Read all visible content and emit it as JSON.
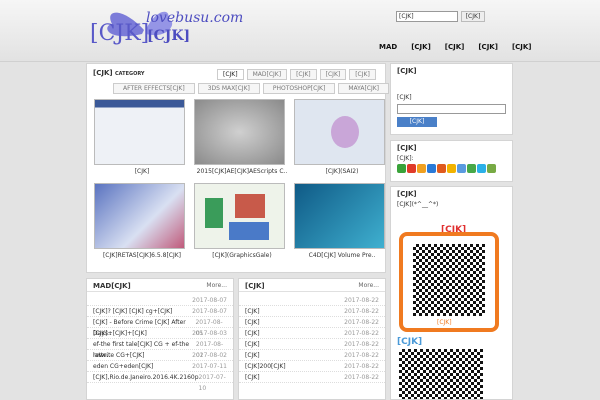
{
  "site": {
    "logo_text": "lovebusu.com",
    "logo_cjk": "[CJK]"
  },
  "search": {
    "placeholder": "[CJK]",
    "button": "[CJK]"
  },
  "nav": [
    "MAD",
    "[CJK]",
    "[CJK]",
    "[CJK]",
    "[CJK]"
  ],
  "category": {
    "title": "[CJK]",
    "title_en": "CATEGORY",
    "tabs": [
      "[CJK]",
      "MAD[CJK]",
      "[CJK]",
      "[CJK]",
      "[CJK]",
      "AFTER EFFECTS[CJK]",
      "3DS MAX[CJK]",
      "PHOTOSHOP[CJK]",
      "MAYA[CJK]"
    ],
    "items": [
      {
        "caption": "[CJK]",
        "thumb_color": "#3b5998"
      },
      {
        "caption": "2015[CJK]AE[CJK]AEScripts C..",
        "thumb_color": "#9c9c9c"
      },
      {
        "caption": "[CJK](SAI2)",
        "thumb_color": "#dfe6f0"
      },
      {
        "caption": "[CJK]RETAS[CJK]6.5.8[CJK]",
        "thumb_color": "#6a7fc0"
      },
      {
        "caption": "[CJK](GraphicsGale)",
        "thumb_color": "#d8e4ce"
      },
      {
        "caption": "C4D[CJK] Volume Pre..",
        "thumb_color": "#1f7fa8"
      }
    ]
  },
  "mad_list": {
    "title": "MAD[CJK]",
    "more": "More...",
    "rows": [
      {
        "t": "",
        "d": "2017-08-07"
      },
      {
        "t": "[CJK]? [CJK] [CJK] cg+[CJK]",
        "d": "2017-08-07"
      },
      {
        "t": "[CJK] - Before Crime [CJK] After Days..",
        "d": "2017-08-05"
      },
      {
        "t": "[CJK]+[CJK]+[CJK]",
        "d": "2017-08-03"
      },
      {
        "t": "ef-the first tale[CJK] CG + ef-the latte..",
        "d": "2017-08-02"
      },
      {
        "t": "rewrite CG+[CJK]",
        "d": "2017-08-02"
      },
      {
        "t": "eden CG+eden[CJK]",
        "d": "2017-07-11"
      },
      {
        "t": "[CJK],Rio.de.Janeiro.2016.4K.2160p",
        "d": "2017-07-10"
      }
    ]
  },
  "news_list": {
    "title": "[CJK]",
    "more": "More...",
    "rows": [
      {
        "t": "",
        "d": "2017-08-22"
      },
      {
        "t": "[CJK]",
        "d": "2017-08-22"
      },
      {
        "t": "[CJK]",
        "d": "2017-08-22"
      },
      {
        "t": "[CJK]",
        "d": "2017-08-22"
      },
      {
        "t": "[CJK]",
        "d": "2017-08-22"
      },
      {
        "t": "[CJK]",
        "d": "2017-08-22"
      },
      {
        "t": "[CJK]200[CJK]",
        "d": "2017-08-22"
      },
      {
        "t": "[CJK]",
        "d": "2017-08-22"
      }
    ]
  },
  "sidebar": {
    "login_title": "[CJK]",
    "login_hint": "[CJK]",
    "login_btn": "[CJK]",
    "share_title": "[CJK]",
    "share_hint": "[CJK]:",
    "share_colors": [
      "#3aa33a",
      "#e03b2a",
      "#f0a020",
      "#2a7ad8",
      "#e05a1e",
      "#f2b300",
      "#5a9be0",
      "#48a848",
      "#2bb0e8",
      "#7a4",
      "#4b4"
    ],
    "wechat_title": "[CJK]",
    "wechat_text": "[CJK](*^__^*)",
    "wechat_big": "[CJK]",
    "qr_label": "[CJK]",
    "bottom_title": "[CJK]"
  }
}
